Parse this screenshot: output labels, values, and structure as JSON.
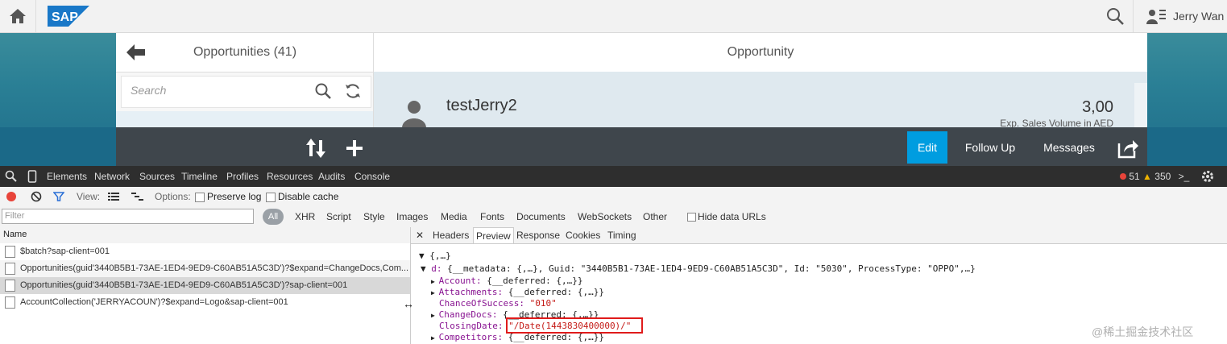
{
  "shell": {
    "logo": "SAP",
    "user_name": "Jerry Wan"
  },
  "master": {
    "title": "Opportunities (41)",
    "search_placeholder": "Search"
  },
  "detail": {
    "title": "Opportunity",
    "object_title": "testJerry2",
    "object_number": "3,00",
    "object_unit": "Exp. Sales Volume in AED"
  },
  "footer": {
    "edit_label": "Edit",
    "follow_up_label": "Follow Up",
    "messages_label": "Messages"
  },
  "devtools": {
    "tabs": [
      "Elements",
      "Network",
      "Sources",
      "Timeline",
      "Profiles",
      "Resources",
      "Audits",
      "Console"
    ],
    "errors": "51",
    "warnings": "350",
    "view_label": "View:",
    "options_label": "Options:",
    "preserve_log": "Preserve log",
    "disable_cache": "Disable cache",
    "filter_placeholder": "Filter",
    "all_label": "All",
    "types": [
      "XHR",
      "Script",
      "Style",
      "Images",
      "Media",
      "Fonts",
      "Documents",
      "WebSockets",
      "Other"
    ],
    "hide_data_urls": "Hide data URLs",
    "name_header": "Name",
    "requests": [
      "$batch?sap-client=001",
      "Opportunities(guid'3440B5B1-73AE-1ED4-9ED9-C60AB51A5C3D')?$expand=ChangeDocs,Com...",
      "Opportunities(guid'3440B5B1-73AE-1ED4-9ED9-C60AB51A5C3D')?sap-client=001",
      "AccountCollection('JERRYACOUN')?$expand=Logo&sap-client=001"
    ],
    "preview_tabs": [
      "Headers",
      "Preview",
      "Response",
      "Cookies",
      "Timing"
    ],
    "preview": {
      "root": "{,…}",
      "d_key": "d:",
      "d_val": "{__metadata: {,…}, Guid: \"3440B5B1-73AE-1ED4-9ED9-C60AB51A5C3D\", Id: \"5030\", ProcessType: \"OPPO\",…}",
      "account_key": "Account:",
      "account_val": "{__deferred: {,…}}",
      "attachments_key": "Attachments:",
      "attachments_val": "{__deferred: {,…}}",
      "chance_key": "ChanceOfSuccess:",
      "chance_val": "\"010\"",
      "changedocs_key": "ChangeDocs:",
      "changedocs_val": "{__deferred: {,…}}",
      "closing_key": "ClosingDate:",
      "closing_val": "\"/Date(1443830400000)/\"",
      "competitors_key": "Competitors:",
      "competitors_val": "{__deferred: {,…}}"
    }
  },
  "watermark": "@稀土掘金技术社区",
  "colors": {
    "accent": "#009de0",
    "footer": "#3f464c",
    "highlight": "#e01b1b"
  }
}
